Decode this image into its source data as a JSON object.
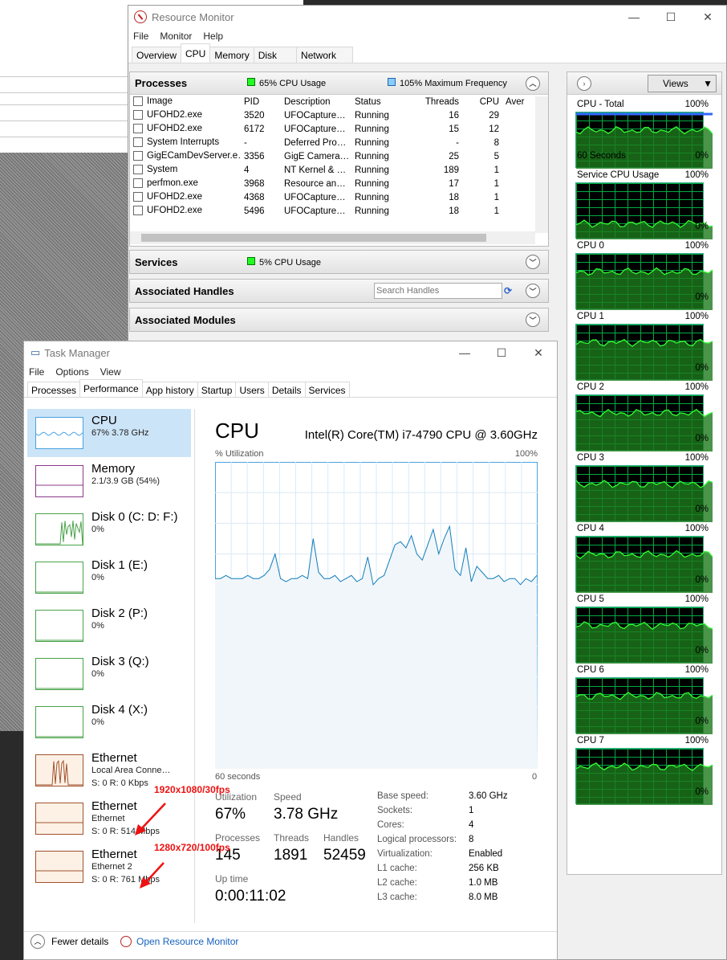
{
  "resource_monitor": {
    "title": "Resource Monitor",
    "menu": [
      "File",
      "Monitor",
      "Help"
    ],
    "tabs": [
      "Overview",
      "CPU",
      "Memory",
      "Disk",
      "Network"
    ],
    "processes": {
      "header": "Processes",
      "cpu_usage": "65% CPU Usage",
      "max_freq": "105% Maximum Frequency",
      "columns": [
        "Image",
        "PID",
        "Description",
        "Status",
        "Threads",
        "CPU",
        "Aver"
      ],
      "rows": [
        [
          "UFOHD2.exe",
          "3520",
          "UFOCapture…",
          "Running",
          "16",
          "29"
        ],
        [
          "UFOHD2.exe",
          "6172",
          "UFOCapture…",
          "Running",
          "15",
          "12"
        ],
        [
          "System Interrupts",
          "-",
          "Deferred Pro…",
          "Running",
          "-",
          "8"
        ],
        [
          "GigECamDevServer.e…",
          "3356",
          "GigE Camera…",
          "Running",
          "25",
          "5"
        ],
        [
          "System",
          "4",
          "NT Kernel & …",
          "Running",
          "189",
          "1"
        ],
        [
          "perfmon.exe",
          "3968",
          "Resource an…",
          "Running",
          "17",
          "1"
        ],
        [
          "UFOHD2.exe",
          "4368",
          "UFOCapture…",
          "Running",
          "18",
          "1"
        ],
        [
          "UFOHD2.exe",
          "5496",
          "UFOCapture…",
          "Running",
          "18",
          "1"
        ]
      ]
    },
    "services": {
      "header": "Services",
      "cpu_usage": "5% CPU Usage"
    },
    "handles": {
      "header": "Associated Handles",
      "search_placeholder": "Search Handles"
    },
    "modules": {
      "header": "Associated Modules"
    },
    "right_panel": {
      "views_label": "Views",
      "graphs": [
        {
          "label": "CPU - Total",
          "top": "100%",
          "bottom_left": "60 Seconds",
          "bottom": "0%"
        },
        {
          "label": "Service CPU Usage",
          "top": "100%",
          "bottom": "0%"
        },
        {
          "label": "CPU 0",
          "top": "100%",
          "bottom": "0%"
        },
        {
          "label": "CPU 1",
          "top": "100%",
          "bottom": "0%"
        },
        {
          "label": "CPU 2",
          "top": "100%",
          "bottom": "0%"
        },
        {
          "label": "CPU 3",
          "top": "100%",
          "bottom": "0%"
        },
        {
          "label": "CPU 4",
          "top": "100%",
          "bottom": "0%"
        },
        {
          "label": "CPU 5",
          "top": "100%",
          "bottom": "0%"
        },
        {
          "label": "CPU 6",
          "top": "100%",
          "bottom": "0%"
        },
        {
          "label": "CPU 7",
          "top": "100%",
          "bottom": "0%"
        }
      ]
    }
  },
  "task_manager": {
    "title": "Task Manager",
    "menu": [
      "File",
      "Options",
      "View"
    ],
    "tabs": [
      "Processes",
      "Performance",
      "App history",
      "Startup",
      "Users",
      "Details",
      "Services"
    ],
    "sidebar": [
      {
        "title": "CPU",
        "sub": "67% 3.78 GHz"
      },
      {
        "title": "Memory",
        "sub": "2.1/3.9 GB (54%)"
      },
      {
        "title": "Disk 0 (C: D: F:)",
        "sub": "0%"
      },
      {
        "title": "Disk 1 (E:)",
        "sub": "0%"
      },
      {
        "title": "Disk 2 (P:)",
        "sub": "0%"
      },
      {
        "title": "Disk 3 (Q:)",
        "sub": "0%"
      },
      {
        "title": "Disk 4 (X:)",
        "sub": "0%"
      },
      {
        "title": "Ethernet",
        "sub": "Local Area Conne…",
        "sub2": "S: 0 R: 0 Kbps"
      },
      {
        "title": "Ethernet",
        "sub": "Ethernet",
        "sub2": "S: 0 R: 514 Mbps"
      },
      {
        "title": "Ethernet",
        "sub": "Ethernet 2",
        "sub2": "S: 0 R: 761 Mbps"
      }
    ],
    "main": {
      "title": "CPU",
      "cpu_name": "Intel(R) Core(TM) i7-4790 CPU @ 3.60GHz",
      "util_label": "% Utilization",
      "util_max": "100%",
      "x_left": "60 seconds",
      "x_right": "0",
      "stats": {
        "utilization_label": "Utilization",
        "utilization": "67%",
        "speed_label": "Speed",
        "speed": "3.78 GHz",
        "processes_label": "Processes",
        "processes": "145",
        "threads_label": "Threads",
        "threads": "1891",
        "handles_label": "Handles",
        "handles": "52459",
        "uptime_label": "Up time",
        "uptime": "0:00:11:02"
      },
      "specs": [
        [
          "Base speed:",
          "3.60 GHz"
        ],
        [
          "Sockets:",
          "1"
        ],
        [
          "Cores:",
          "4"
        ],
        [
          "Logical processors:",
          "8"
        ],
        [
          "Virtualization:",
          "Enabled"
        ],
        [
          "L1 cache:",
          "256 KB"
        ],
        [
          "L2 cache:",
          "1.0 MB"
        ],
        [
          "L3 cache:",
          "8.0 MB"
        ]
      ]
    },
    "footer": {
      "fewer": "Fewer details",
      "open_rm": "Open Resource Monitor"
    }
  },
  "annotations": [
    "1920x1080/30fps",
    "1280x720/100fps"
  ],
  "chart_data": {
    "type": "line",
    "title": "% Utilization",
    "ylim": [
      0,
      100
    ],
    "values": [
      62,
      62,
      63,
      62,
      62,
      62,
      63,
      62,
      62,
      63,
      65,
      70,
      62,
      61,
      62,
      62,
      63,
      62,
      75,
      64,
      62,
      62,
      63,
      61,
      62,
      63,
      61,
      62,
      69,
      60,
      62,
      63,
      68,
      73,
      74,
      72,
      76,
      70,
      68,
      73,
      78,
      70,
      75,
      79,
      65,
      63,
      72,
      61,
      66,
      64,
      62,
      62,
      63,
      61,
      62,
      62,
      60,
      62,
      61,
      63
    ]
  }
}
